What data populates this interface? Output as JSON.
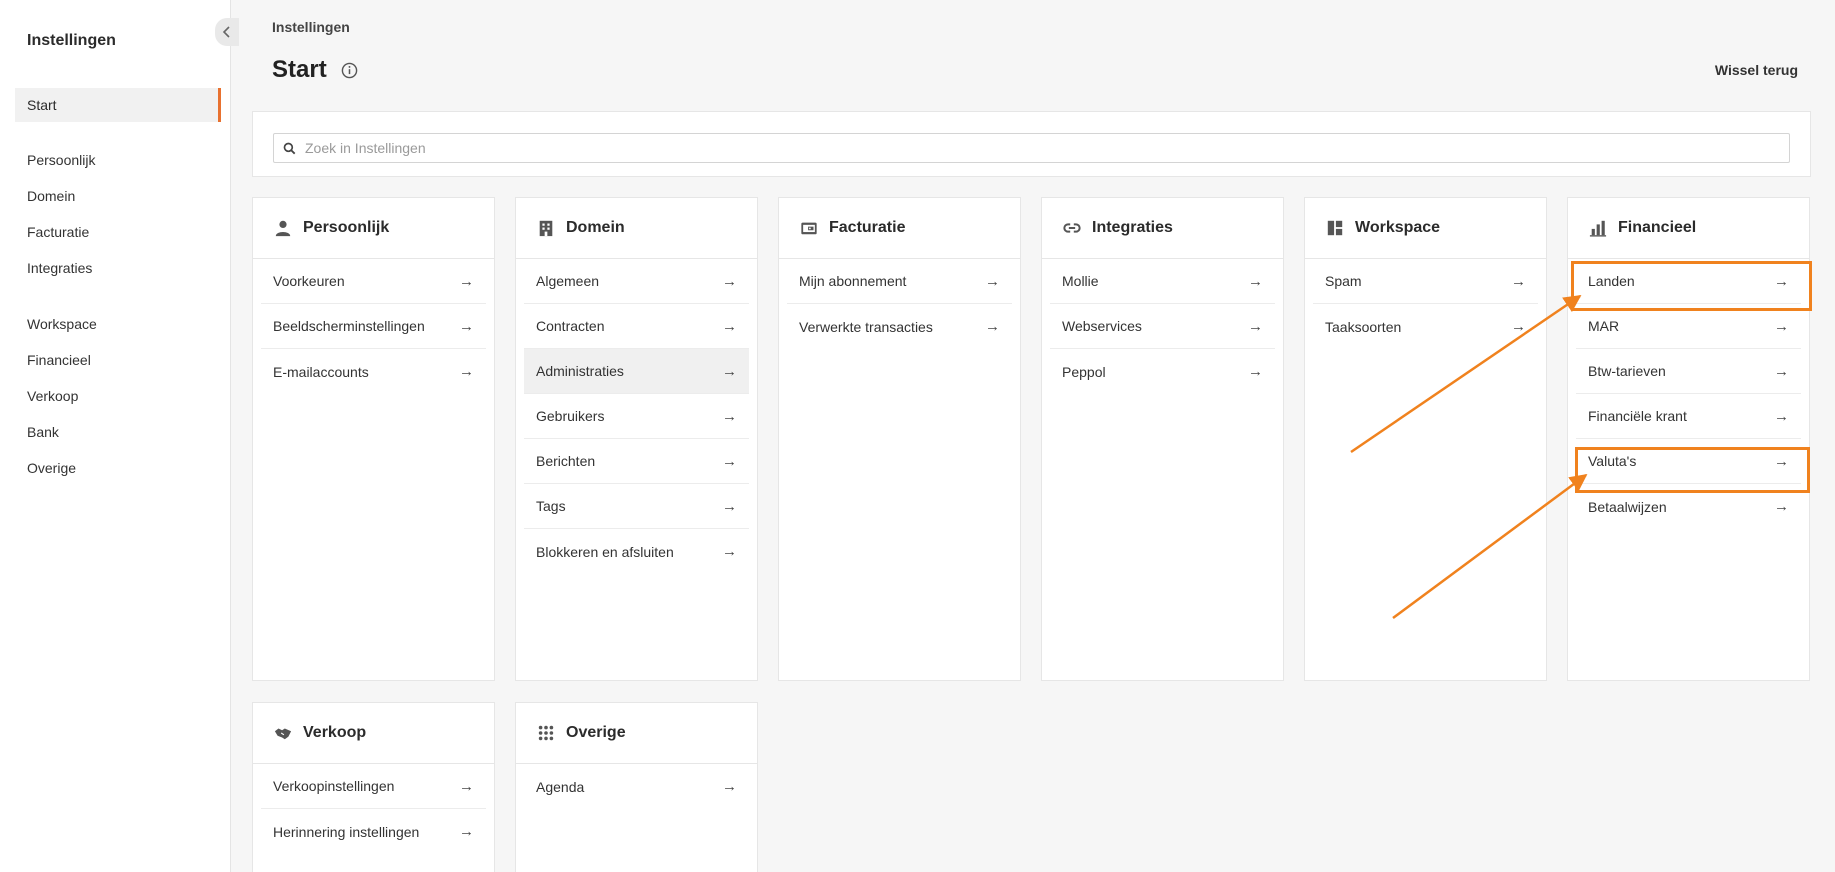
{
  "sidebar": {
    "title": "Instellingen",
    "active": "Start",
    "items": [
      "Persoonlijk",
      "Domein",
      "Facturatie",
      "Integraties",
      "Workspace",
      "Financieel",
      "Verkoop",
      "Bank",
      "Overige"
    ]
  },
  "header": {
    "breadcrumb": "Instellingen",
    "title": "Start",
    "switch_back": "Wissel terug"
  },
  "search": {
    "placeholder": "Zoek in Instellingen"
  },
  "cards": [
    {
      "title": "Persoonlijk",
      "icon": "person-icon",
      "items": [
        "Voorkeuren",
        "Beeldscherminstellingen",
        "E-mailaccounts"
      ]
    },
    {
      "title": "Domein",
      "icon": "building-icon",
      "items": [
        "Algemeen",
        "Contracten",
        "Administraties",
        "Gebruikers",
        "Berichten",
        "Tags",
        "Blokkeren en afsluiten"
      ]
    },
    {
      "title": "Facturatie",
      "icon": "wallet-icon",
      "items": [
        "Mijn abonnement",
        "Verwerkte transacties"
      ]
    },
    {
      "title": "Integraties",
      "icon": "link-icon",
      "items": [
        "Mollie",
        "Webservices",
        "Peppol"
      ]
    },
    {
      "title": "Workspace",
      "icon": "dashboard-icon",
      "items": [
        "Spam",
        "Taaksoorten"
      ]
    },
    {
      "title": "Financieel",
      "icon": "bar-chart-icon",
      "items": [
        "Landen",
        "MAR",
        "Btw-tarieven",
        "Financiële krant",
        "Valuta's",
        "Betaalwijzen"
      ]
    },
    {
      "title": "Verkoop",
      "icon": "handshake-icon",
      "items": [
        "Verkoopinstellingen",
        "Herinnering instellingen"
      ]
    },
    {
      "title": "Overige",
      "icon": "grid-dots-icon",
      "items": [
        "Agenda"
      ]
    }
  ],
  "arrow_glyph": "→",
  "colors": {
    "accent": "#e8712f",
    "annotation": "#f0821e"
  }
}
